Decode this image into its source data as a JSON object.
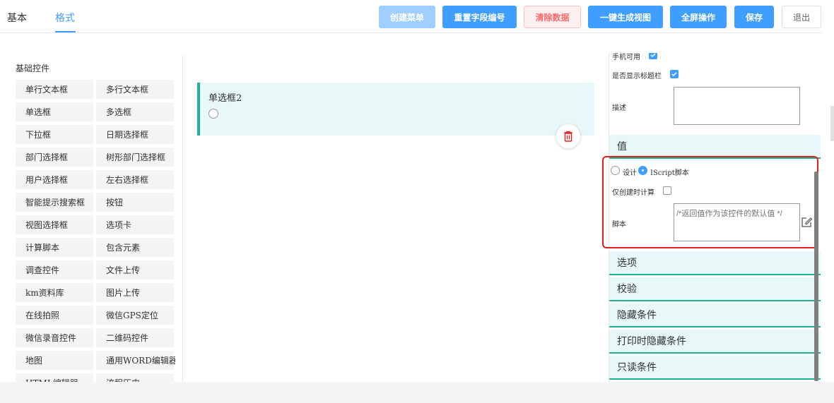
{
  "tabs": {
    "basic": "基本",
    "format": "格式"
  },
  "toolbar": {
    "create_menu": "创建菜单",
    "reset_field_numbers": "重置字段编号",
    "clear_data": "清除数据",
    "generate_view": "一键生成视图",
    "fullscreen": "全屏操作",
    "save": "保存",
    "exit": "退出"
  },
  "palette": {
    "title": "基础控件",
    "items": [
      "单行文本框",
      "多行文本框",
      "单选框",
      "多选框",
      "下拉框",
      "日期选择框",
      "部门选择框",
      "树形部门选择框",
      "用户选择框",
      "左右选择框",
      "智能提示搜索框",
      "按钮",
      "视图选择框",
      "选项卡",
      "计算脚本",
      "包含元素",
      "调查控件",
      "文件上传",
      "km资料库",
      "图片上传",
      "在线拍照",
      "微信GPS定位",
      "微信录音控件",
      "二维码控件",
      "地图",
      "通用WORD编辑器",
      "HTML编辑器",
      "流程历史"
    ]
  },
  "canvas": {
    "field_label": "单选框2"
  },
  "props": {
    "mobile_label": "手机可用",
    "mobile_checked": true,
    "show_title_label": "是否显示标题栏",
    "show_title_checked": true,
    "desc_label": "描述",
    "value_section": "值",
    "radio_design": "设计",
    "radio_iscript": "IScript脚本",
    "radio_selected": "IScript脚本",
    "only_create_label": "仅创建时计算",
    "only_create_checked": false,
    "script_label": "脚本",
    "script_placeholder": "/*返回值作为该控件的默认值 */",
    "sections": [
      "选项",
      "校验",
      "隐藏条件",
      "打印时隐藏条件",
      "只读条件"
    ]
  },
  "colors": {
    "primary": "#409eff",
    "accent": "#1ab394",
    "danger": "#f56c6c",
    "highlight": "#e02020"
  },
  "icons": {
    "trash": "trash-icon",
    "edit": "edit-icon",
    "check": "check-icon"
  }
}
